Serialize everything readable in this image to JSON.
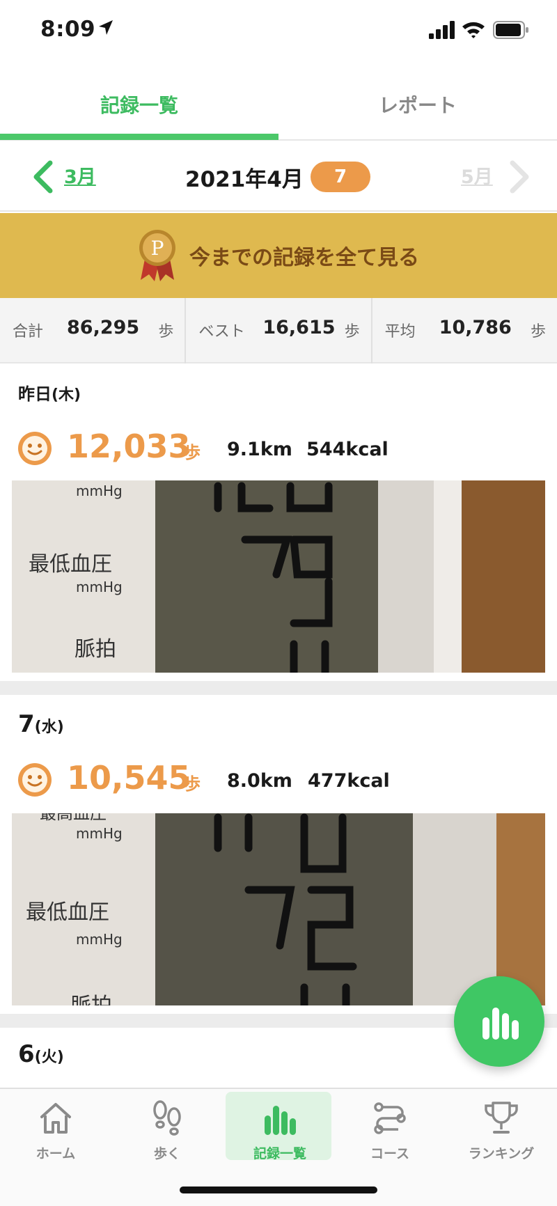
{
  "status_bar": {
    "time": "8:09",
    "icons": [
      "location-arrow-icon",
      "cellular-signal-icon",
      "wifi-icon",
      "battery-icon"
    ]
  },
  "tabs": [
    {
      "label": "記録一覧",
      "active": true
    },
    {
      "label": "レポート",
      "active": false
    }
  ],
  "month_nav": {
    "prev_label": "3月",
    "current_label": "2021年4月",
    "badge": "7",
    "next_label": "5月"
  },
  "banner": {
    "label": "今までの記録を全て見る",
    "medal_letter": "P"
  },
  "stats": [
    {
      "label": "合計",
      "value": "86,295",
      "unit": "歩"
    },
    {
      "label": "ベスト",
      "value": "16,615",
      "unit": "歩"
    },
    {
      "label": "平均",
      "value": "10,786",
      "unit": "歩"
    }
  ],
  "entries": [
    {
      "title": "昨日",
      "weekday": "(木)",
      "steps": "12,033",
      "steps_unit": "歩",
      "distance": "9.1km",
      "kcal": "544kcal",
      "photo": {
        "labels": [
          "mmHg",
          "最低血圧",
          "mmHg",
          "脈拍"
        ]
      }
    },
    {
      "title": "7",
      "weekday": "(水)",
      "steps": "10,545",
      "steps_unit": "歩",
      "distance": "8.0km",
      "kcal": "477kcal",
      "photo": {
        "labels": [
          "最高血圧",
          "mmHg",
          "最低血圧",
          "mmHg",
          "脈拍"
        ]
      }
    },
    {
      "title": "6",
      "weekday": "(火)"
    }
  ],
  "bottom_nav": [
    {
      "label": "ホーム",
      "icon": "home-icon",
      "active": false
    },
    {
      "label": "歩く",
      "icon": "footprints-icon",
      "active": false
    },
    {
      "label": "記録一覧",
      "icon": "bar-chart-icon",
      "active": true
    },
    {
      "label": "コース",
      "icon": "route-icon",
      "active": false
    },
    {
      "label": "ランキング",
      "icon": "trophy-icon",
      "active": false
    }
  ],
  "colors": {
    "accent_green": "#3dbb60",
    "step_orange": "#ec9a4a",
    "banner_gold": "#dfb94f",
    "banner_text": "#7a4a16"
  }
}
